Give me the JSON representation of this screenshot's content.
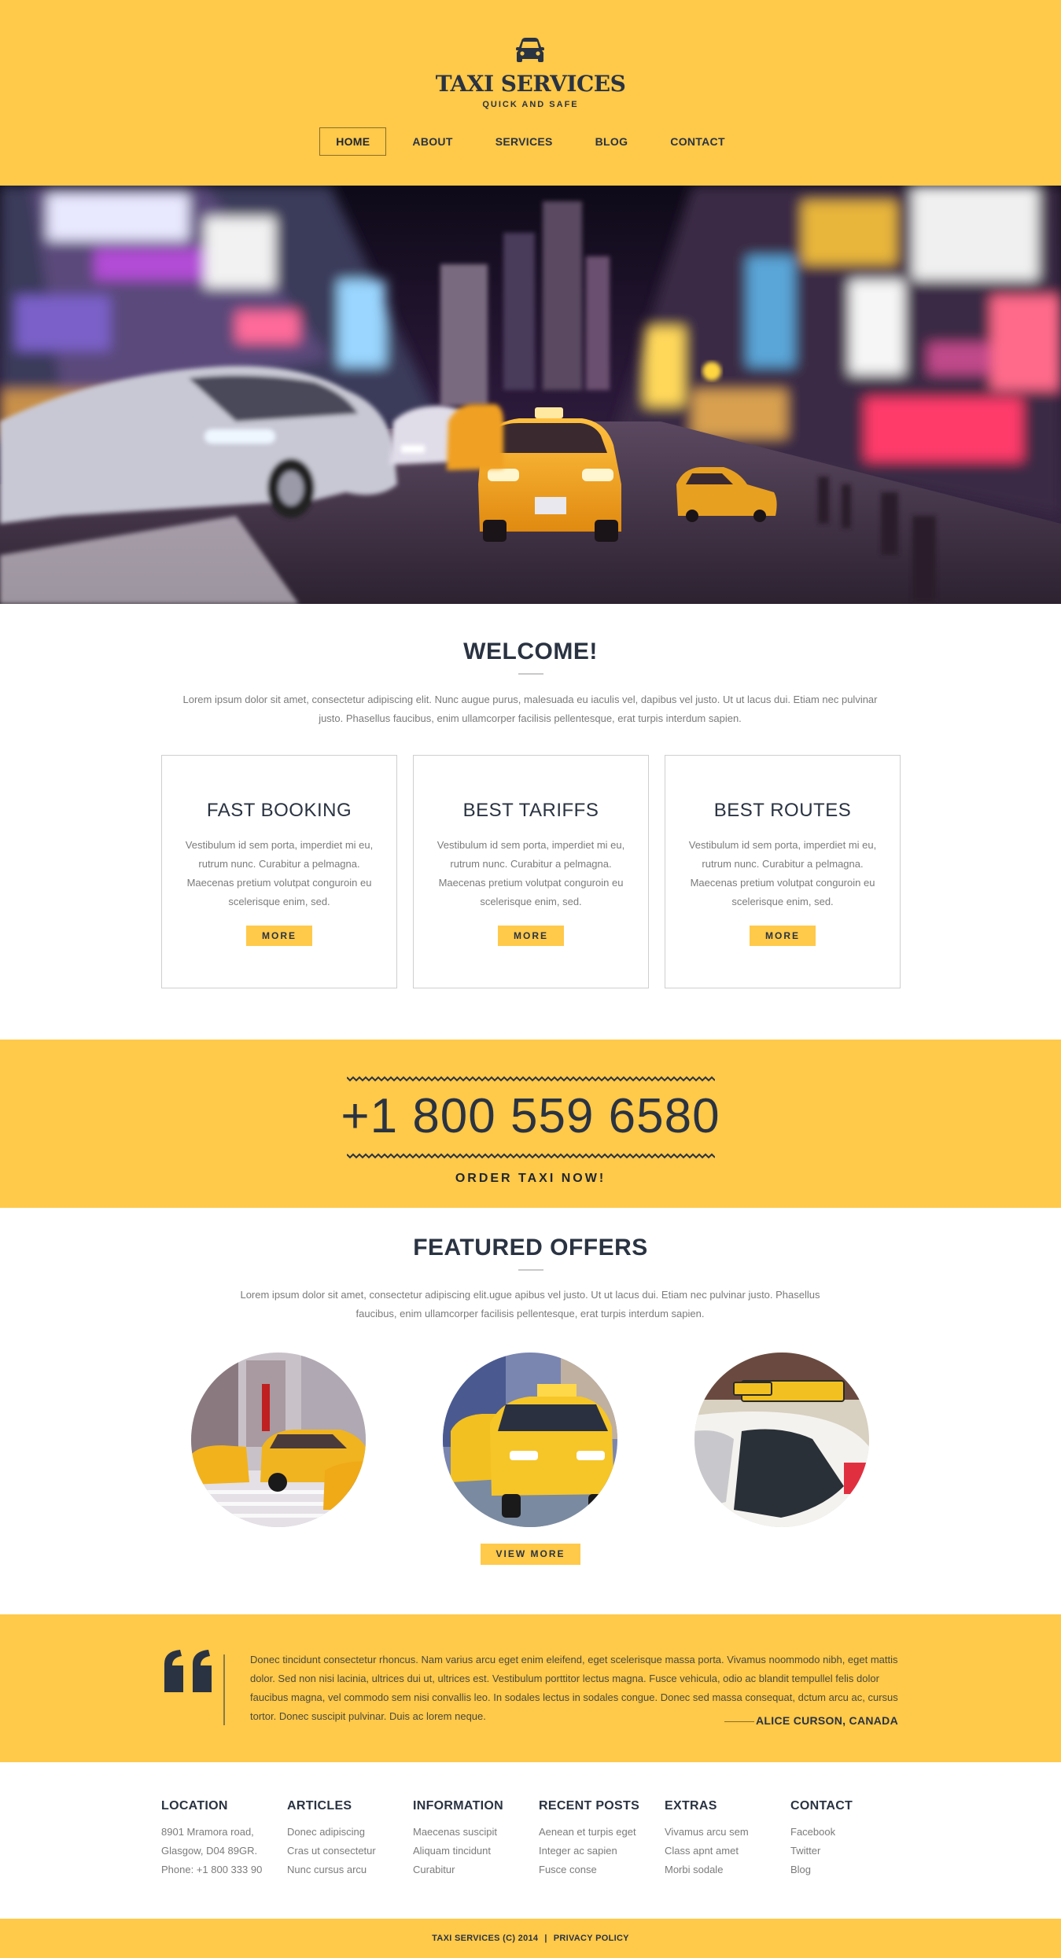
{
  "colors": {
    "accent": "#ffc94a",
    "dark": "#2a3342",
    "muted": "#7b7b7b"
  },
  "header": {
    "logo_icon": "taxi-car-icon",
    "brand": "TAXI SERVICES",
    "tagline": "QUICK AND SAFE",
    "nav": [
      {
        "label": "HOME",
        "active": true
      },
      {
        "label": "ABOUT",
        "active": false
      },
      {
        "label": "SERVICES",
        "active": false
      },
      {
        "label": "BLOG",
        "active": false
      },
      {
        "label": "CONTACT",
        "active": false
      }
    ]
  },
  "welcome": {
    "title": "WELCOME!",
    "text": "Lorem ipsum dolor sit amet, consectetur adipiscing elit. Nunc augue purus, malesuada eu iaculis vel, dapibus vel justo. Ut ut lacus dui. Etiam nec pulvinar justo. Phasellus faucibus, enim ullamcorper facilisis pellentesque, erat turpis interdum sapien.",
    "features": [
      {
        "title": "FAST BOOKING",
        "text": "Vestibulum id sem porta, imperdiet mi eu, rutrum nunc. Curabitur a pelmagna. Maecenas pretium volutpat conguroin eu scelerisque enim, sed.",
        "button": "MORE"
      },
      {
        "title": "BEST TARIFFS",
        "text": "Vestibulum id sem porta, imperdiet mi eu, rutrum nunc. Curabitur a pelmagna. Maecenas pretium volutpat conguroin eu scelerisque enim, sed.",
        "button": "MORE"
      },
      {
        "title": "BEST ROUTES",
        "text": "Vestibulum id sem porta, imperdiet mi eu, rutrum nunc. Curabitur a pelmagna. Maecenas pretium volutpat conguroin eu scelerisque enim, sed.",
        "button": "MORE"
      }
    ]
  },
  "phone_band": {
    "phone": "+1 800 559 6580",
    "cta": "ORDER TAXI NOW!"
  },
  "featured": {
    "title": "FEATURED OFFERS",
    "text": "Lorem ipsum dolor sit amet, consectetur adipiscing elit.ugue apibus vel justo. Ut ut lacus dui. Etiam nec pulvinar justo. Phasellus faucibus, enim ullamcorper facilisis pellentesque, erat turpis interdum sapien.",
    "button": "VIEW MORE"
  },
  "testimonial": {
    "quote_icon": "quote-icon",
    "text": "Donec tincidunt consectetur rhoncus. Nam varius arcu eget enim eleifend, eget scelerisque massa porta. Vivamus noommodo nibh, eget mattis dolor. Sed non nisi lacinia, ultrices dui ut, ultrices est. Vestibulum porttitor lectus magna. Fusce vehicula, odio ac blandit tempullel felis dolor faucibus magna, vel commodo sem nisi convallis leo. In sodales lectus in sodales congue. Donec sed massa consequat, dctum arcu ac, cursus tortor. Donec suscipit pulvinar. Duis ac lorem neque.",
    "author": "ALICE CURSON, CANADA"
  },
  "footer": {
    "columns": [
      {
        "title": "LOCATION",
        "lines": [
          "8901 Mramora road,",
          "Glasgow, D04 89GR.",
          "Phone: +1 800 333 90"
        ],
        "links": false
      },
      {
        "title": "ARTICLES",
        "lines": [
          "Donec adipiscing",
          "Cras ut consectetur",
          "Nunc cursus arcu"
        ],
        "links": true
      },
      {
        "title": "INFORMATION",
        "lines": [
          "Maecenas suscipit",
          "Aliquam tincidunt",
          "Curabitur"
        ],
        "links": true
      },
      {
        "title": "RECENT POSTS",
        "lines": [
          "Aenean et turpis eget",
          "Integer ac sapien",
          "Fusce conse"
        ],
        "links": true
      },
      {
        "title": "EXTRAS",
        "lines": [
          "Vivamus arcu sem",
          "Class apnt amet",
          "Morbi sodale"
        ],
        "links": true
      },
      {
        "title": "CONTACT",
        "lines": [
          "Facebook",
          "Twitter",
          "Blog"
        ],
        "links": true
      }
    ],
    "copyright": "TAXI SERVICES (C) 2014",
    "separator": "|",
    "privacy": "PRIVACY POLICY"
  }
}
